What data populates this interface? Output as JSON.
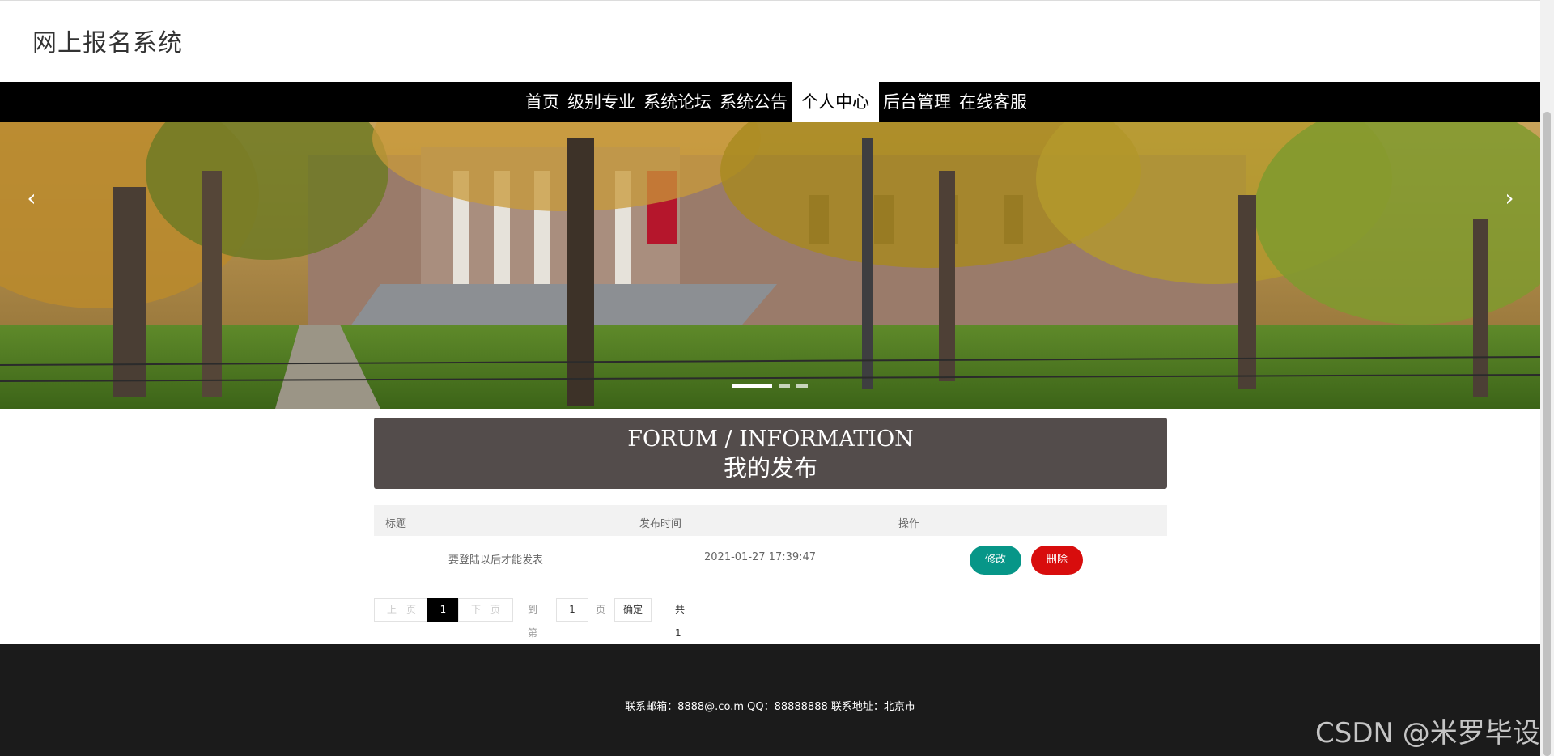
{
  "header": {
    "site_title": "网上报名系统"
  },
  "nav": {
    "items": [
      {
        "label": "首页"
      },
      {
        "label": "级别专业"
      },
      {
        "label": "系统论坛"
      },
      {
        "label": "系统公告"
      },
      {
        "label": "个人中心",
        "active": true
      },
      {
        "label": "后台管理"
      },
      {
        "label": "在线客服"
      }
    ]
  },
  "banner": {
    "slide_count": 3,
    "active_slide": 1,
    "prev_icon": "chevron-left-icon",
    "next_icon": "chevron-right-icon"
  },
  "section": {
    "title_en": "FORUM / INFORMATION",
    "title_cn": "我的发布"
  },
  "table": {
    "columns": [
      "标题",
      "发布时间",
      "操作"
    ],
    "rows": [
      {
        "title": "要登陆以后才能发表",
        "time": "2021-01-27 17:39:47",
        "edit_label": "修改",
        "delete_label": "删除"
      }
    ]
  },
  "pagination": {
    "prev_label": "上一页",
    "current_page": "1",
    "next_label": "下一页",
    "goto_label": "到第",
    "goto_value": "1",
    "page_unit": "页",
    "confirm_label": "确定",
    "total_label": "共 1 条"
  },
  "footer": {
    "text": "联系邮箱：8888@.co.m QQ：88888888 联系地址：北京市"
  },
  "watermark": "CSDN @米罗毕设",
  "colors": {
    "nav_bg": "#000000",
    "title_box_bg": "#534c4b",
    "edit_btn": "#079688",
    "delete_btn": "#d80d0d",
    "footer_bg": "#1b1b1b"
  }
}
